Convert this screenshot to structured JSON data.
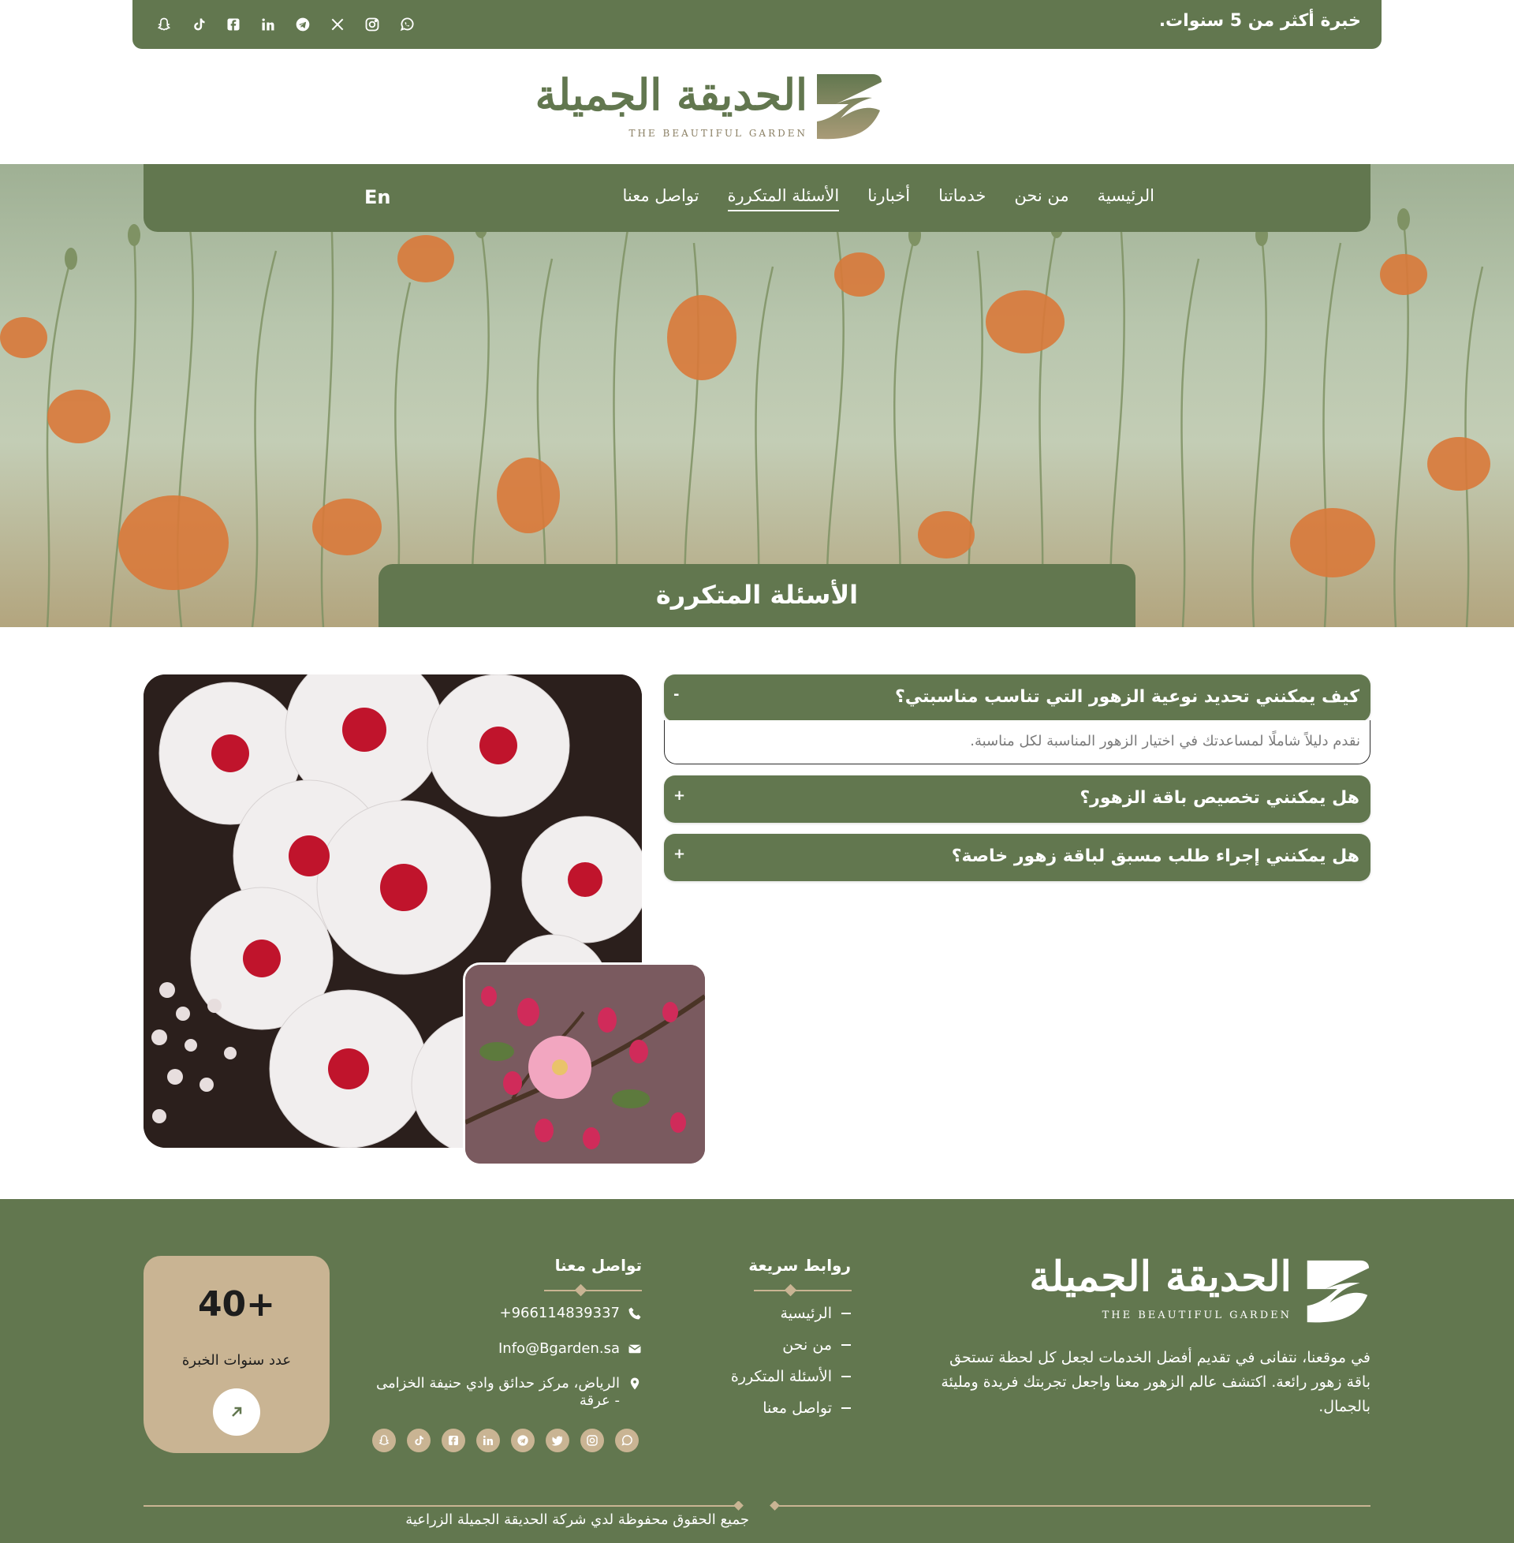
{
  "topbar": {
    "experience_text": "خبرة أكثر من 5 سنوات.",
    "social_icons": [
      "whatsapp-icon",
      "instagram-icon",
      "x-icon",
      "telegram-icon",
      "linkedin-icon",
      "facebook-icon",
      "tiktok-icon",
      "snapchat-icon"
    ]
  },
  "brand": {
    "name_ar": "الحديقة الجميلة",
    "name_en": "THE BEAUTIFUL GARDEN",
    "primary_color": "#62774f",
    "accent_color": "#c9b493"
  },
  "nav": {
    "items": [
      {
        "label": "الرئيسية"
      },
      {
        "label": "من نحن"
      },
      {
        "label": "خدماتنا"
      },
      {
        "label": "أخبارنا"
      },
      {
        "label": "الأسئلة المتكررة",
        "active": true
      },
      {
        "label": "تواصل معنا"
      }
    ],
    "lang_label": "En"
  },
  "hero": {
    "title": "الأسئلة المتكررة"
  },
  "faq": [
    {
      "question": "كيف يمكنني تحديد نوعية الزهور التي تناسب مناسبتي؟",
      "answer": "نقدم دليلاً شاملًا لمساعدتك في اختيار الزهور المناسبة لكل مناسبة.",
      "sign": "-",
      "expanded": true
    },
    {
      "question": "هل يمكنني تخصيص باقة الزهور؟",
      "sign": "+",
      "expanded": false
    },
    {
      "question": "هل يمكنني إجراء طلب مسبق لباقة زهور خاصة؟",
      "sign": "+",
      "expanded": false
    }
  ],
  "footer": {
    "description": "في موقعنا، نتفانى في تقديم أفضل الخدمات لجعل كل لحظة تستحق باقة زهور رائعة. اكتشف عالم الزهور معنا واجعل تجربتك فريدة ومليئة بالجمال.",
    "quick_links": {
      "title": "روابط سريعة",
      "items": [
        "الرئيسية",
        "من نحن",
        "الأسئلة المتكررة",
        "تواصل معنا"
      ]
    },
    "contact": {
      "title": "تواصل معنا",
      "phone": "+966114839337",
      "email": "Info@Bgarden.sa",
      "address": "الرياض، مركز حدائق وادي حنيفة الخزامى - عرقة"
    },
    "social_icons": [
      "whatsapp-icon",
      "instagram-icon",
      "twitter-icon",
      "telegram-icon",
      "linkedin-icon",
      "facebook-icon",
      "tiktok-icon",
      "snapchat-icon"
    ],
    "experience": {
      "number": "40+",
      "label": "عدد سنوات الخبرة"
    },
    "copyright": "جميع الحقوق محفوظة لدي شركة الحديقة الجميلة الزراعية"
  }
}
